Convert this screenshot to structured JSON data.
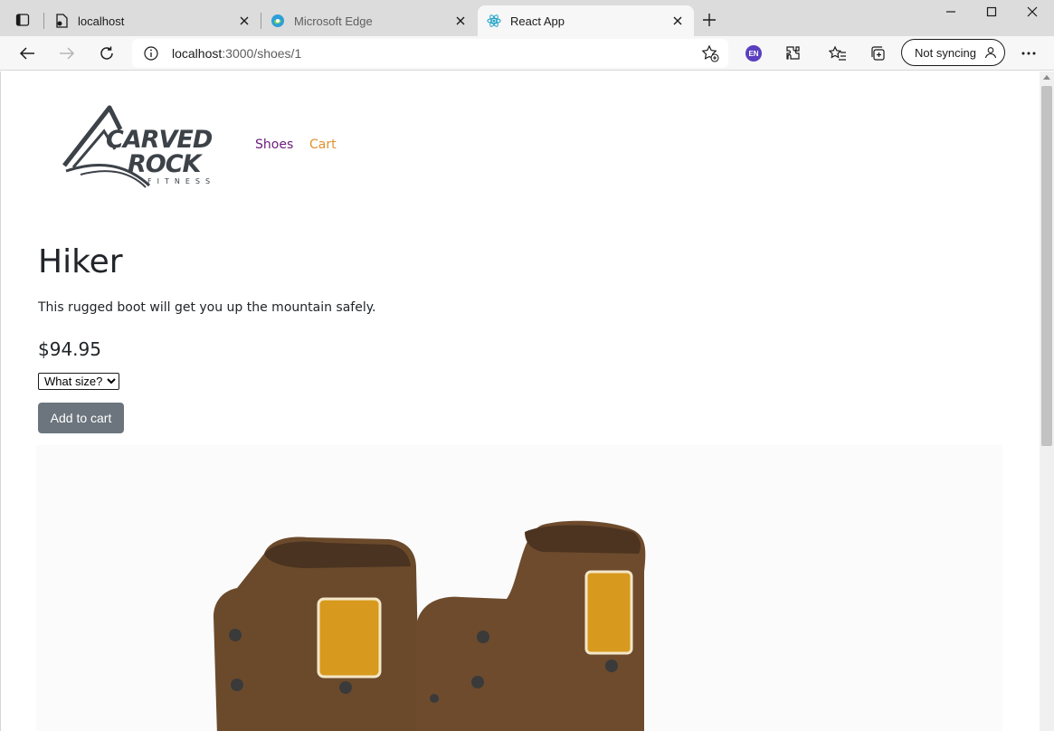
{
  "browser": {
    "tabs": [
      {
        "title": "localhost",
        "favicon": "document-icon"
      },
      {
        "title": "Microsoft Edge",
        "favicon": "edge-logo-icon"
      },
      {
        "title": "React App",
        "favicon": "react-logo-icon",
        "active": true
      }
    ],
    "address": {
      "host": "localhost",
      "path": ":3000/shoes/1"
    },
    "profile_badge": "EN",
    "sync_label": "Not syncing"
  },
  "page": {
    "logo_alt": "Carved Rock Fitness",
    "nav": {
      "shoes": "Shoes",
      "cart": "Cart"
    },
    "product": {
      "name": "Hiker",
      "description": "This rugged boot will get you up the mountain safely.",
      "price": "$94.95",
      "size_placeholder": "What size?",
      "add_to_cart": "Add to cart"
    }
  },
  "colors": {
    "nav_shoes": "#6a1b7a",
    "nav_cart": "#e09030",
    "button_bg": "#6c757d"
  }
}
